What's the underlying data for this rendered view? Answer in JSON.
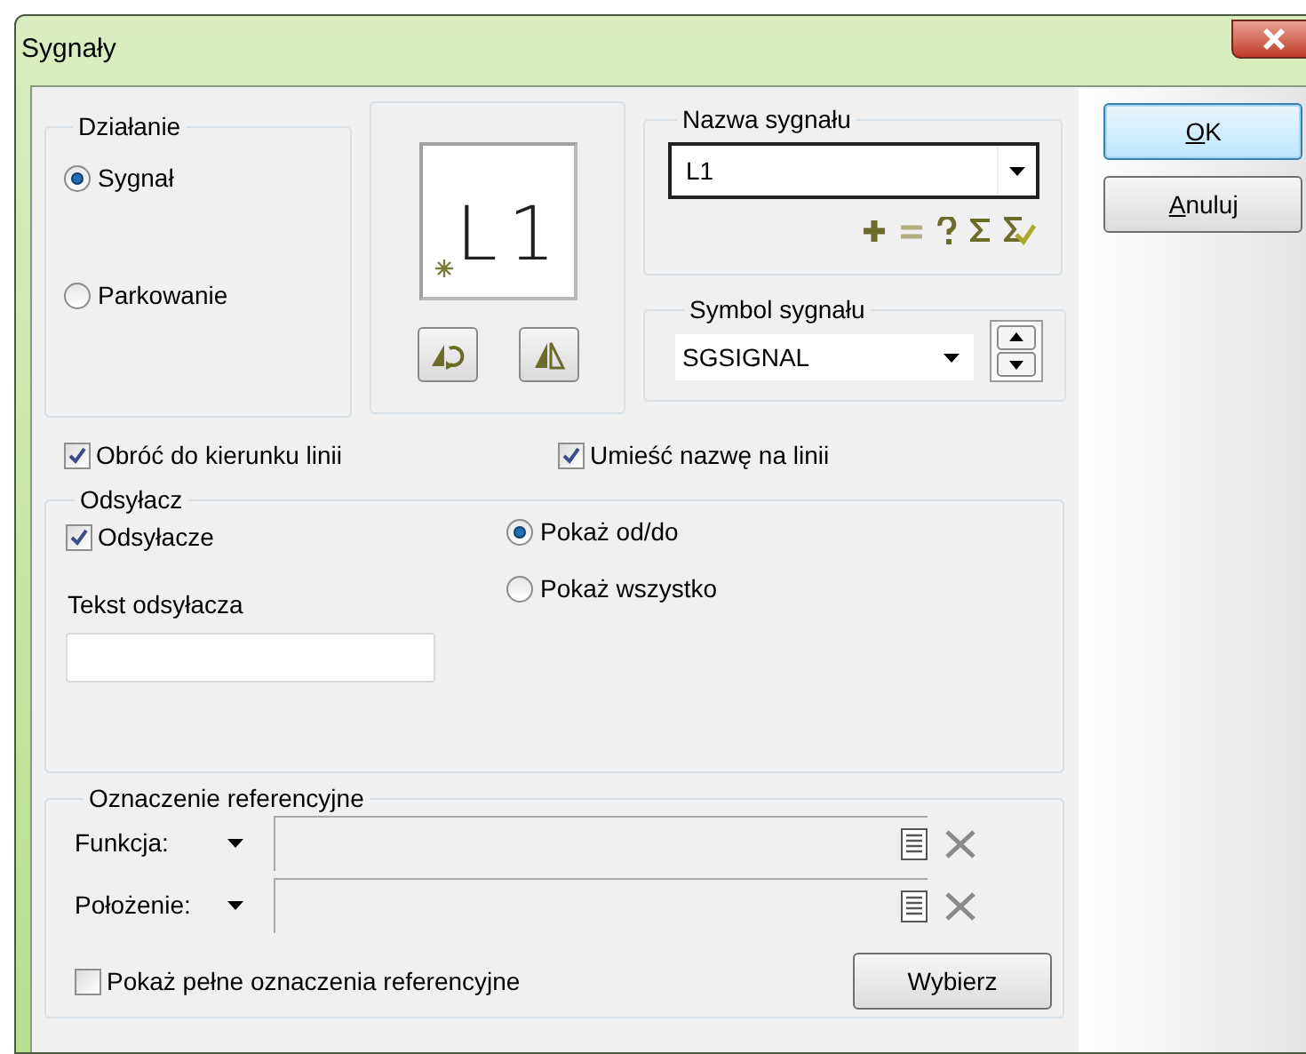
{
  "window": {
    "title": "Sygnały"
  },
  "action_group": {
    "title": "Działanie",
    "options": [
      {
        "label": "Sygnał",
        "selected": true
      },
      {
        "label": "Parkowanie",
        "selected": false
      }
    ]
  },
  "preview": {
    "text": "L1"
  },
  "signal_name": {
    "title": "Nazwa sygnału",
    "value": "L1"
  },
  "signal_symbol": {
    "title": "Symbol sygnału",
    "value": "SGSIGNAL"
  },
  "options": [
    {
      "label": "Obróć do kierunku linii",
      "checked": true
    },
    {
      "label": "Umieść nazwę na linii",
      "checked": true
    }
  ],
  "cross_reference": {
    "title": "Odsyłacz",
    "enabled": {
      "label": "Odsyłacze",
      "checked": true
    },
    "text_label": "Tekst odsyłacza",
    "display": [
      {
        "label": "Pokaż od/do",
        "selected": true
      },
      {
        "label": "Pokaż wszystko",
        "selected": false
      }
    ]
  },
  "reference_designation": {
    "title": "Oznaczenie referencyjne",
    "fields": [
      {
        "label": "Funkcja:",
        "disabled": true
      },
      {
        "label": "Położenie:",
        "disabled": true
      }
    ],
    "full": {
      "label": "Pokaż pełne oznaczenia referencyjne",
      "checked": false
    },
    "select_button": "Wybierz"
  },
  "buttons": [
    {
      "label": "OK",
      "default": true,
      "mnemonic": true
    },
    {
      "label": "Anuluj",
      "default": false,
      "mnemonic": true
    }
  ]
}
